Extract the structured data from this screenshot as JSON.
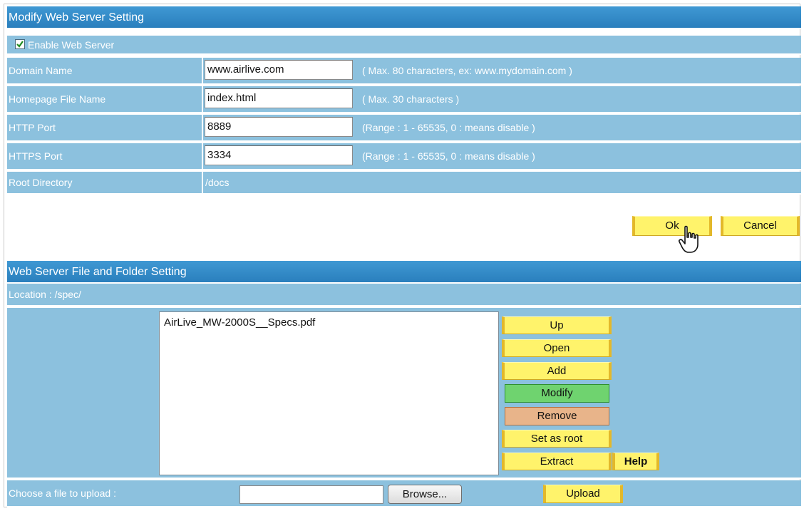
{
  "web_server": {
    "header": "Modify Web Server Setting",
    "enable_label": "Enable Web Server",
    "enabled": true,
    "fields": [
      {
        "label": "Domain Name",
        "value": "www.airlive.com",
        "hint": "( Max. 80 characters, ex: www.mydomain.com )"
      },
      {
        "label": "Homepage File Name",
        "value": "index.html",
        "hint": "( Max. 30 characters )"
      },
      {
        "label": "HTTP Port",
        "value": "8889",
        "hint": "(Range : 1 - 65535, 0 : means disable )"
      },
      {
        "label": "HTTPS Port",
        "value": "3334",
        "hint": "(Range : 1 - 65535, 0 : means disable )"
      }
    ],
    "root_dir_label": "Root Directory",
    "root_dir_value": "/docs",
    "ok_label": "Ok",
    "cancel_label": "Cancel"
  },
  "file_folder": {
    "header": "Web Server File and Folder Setting",
    "location": "Location : /spec/",
    "files": [
      "AirLive_MW-2000S__Specs.pdf"
    ],
    "actions": {
      "up": "Up",
      "open": "Open",
      "add": "Add",
      "modify": "Modify",
      "remove": "Remove",
      "set_root": "Set as root",
      "extract": "Extract",
      "help": "Help"
    },
    "upload_label": "Choose a file to upload :",
    "browse_label": "Browse...",
    "upload_button": "Upload"
  },
  "colors": {
    "header_blue": "#2a7fbd",
    "row_blue": "#8cc1de",
    "button_yellow": "#fff36b",
    "modify_green": "#6fd36f",
    "remove_orange": "#e8b48a"
  },
  "icons": [
    "checkbox-checked-icon",
    "hand-cursor-icon"
  ]
}
